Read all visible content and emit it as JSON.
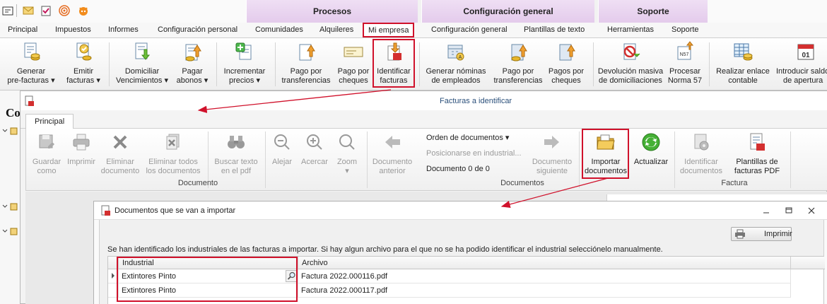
{
  "ribbon_groups": {
    "procesos": "Procesos",
    "configuracion": "Configuración general",
    "soporte": "Soporte"
  },
  "tabs": [
    "Principal",
    "Impuestos",
    "Informes",
    "Configuración personal",
    "Comunidades",
    "Alquileres",
    "Mi empresa",
    "Configuración general",
    "Plantillas de texto",
    "Herramientas",
    "Soporte"
  ],
  "ribbon_buttons": {
    "generar_prefacturas": [
      "Generar",
      "pre-facturas ▾"
    ],
    "emitir_facturas": [
      "Emitir",
      "facturas ▾"
    ],
    "domiciliar": [
      "Domiciliar",
      "Vencimientos ▾"
    ],
    "pagar_abonos": [
      "Pagar",
      "abonos ▾"
    ],
    "incrementar_precios": [
      "Incrementar",
      "precios ▾"
    ],
    "pago_transferencias": [
      "Pago por",
      "transferencias"
    ],
    "pago_cheques": [
      "Pago por",
      "cheques"
    ],
    "identificar_facturas": [
      "Identificar",
      "facturas"
    ],
    "generar_nominas": [
      "Generar nóminas",
      "de empleados"
    ],
    "pagos_transferencias": [
      "Pago por",
      "transferencias"
    ],
    "pagos_cheques": [
      "Pagos por",
      "cheques"
    ],
    "devolucion_masiva": [
      "Devolución masiva",
      "de domiciliaciones"
    ],
    "procesar_norma": [
      "Procesar",
      "Norma 57"
    ],
    "realizar_enlace": [
      "Realizar enlace",
      "contable"
    ],
    "introducir_saldo": [
      "Introducir saldo",
      "de apertura"
    ]
  },
  "left_partial_text": "Co",
  "facturas_window": {
    "title": "Facturas a identificar",
    "tab": "Principal",
    "buttons": {
      "guardar": [
        "Guardar",
        "como"
      ],
      "imprimir": [
        "Imprimir",
        ""
      ],
      "eliminar": [
        "Eliminar",
        "documento"
      ],
      "eliminar_todos": [
        "Eliminar todos",
        "los documentos"
      ],
      "buscar_texto": [
        "Buscar texto",
        "en el pdf"
      ],
      "alejar": [
        "Alejar",
        ""
      ],
      "acercar": [
        "Acercar",
        ""
      ],
      "zoom": [
        "Zoom",
        "▾"
      ],
      "doc_anterior": [
        "Documento",
        "anterior"
      ],
      "doc_siguiente": [
        "Documento",
        "siguiente"
      ],
      "importar": [
        "Importar",
        "documentos"
      ],
      "actualizar": [
        "Actualizar",
        ""
      ],
      "identificar_docs": [
        "Identificar",
        "documentos"
      ],
      "plantillas_pdf": [
        "Plantillas de",
        "facturas PDF"
      ]
    },
    "orden_label": "Orden de documentos ▾",
    "posicionarse": "Posicionarse en industrial...",
    "doc_counter": "Documento 0 de 0",
    "group_labels": {
      "documento": "Documento",
      "documentos": "Documentos",
      "factura": "Factura"
    }
  },
  "dialog": {
    "title": "Documentos que se van a importar",
    "print_label": "Imprimir",
    "message": "Se han identificado los industriales de las facturas a importar. Si hay algun archivo para el que no se ha podido identificar el industrial selecciónelo manualmente.",
    "columns": [
      "Industrial",
      "Archivo"
    ],
    "rows": [
      {
        "industrial": "Extintores Pinto",
        "archivo": "Factura 2022.000116.pdf"
      },
      {
        "industrial": "Extintores Pinto",
        "archivo": "Factura 2022.000117.pdf"
      }
    ]
  },
  "colors": {
    "highlight_red": "#d0112b",
    "group_header": "#e9d3f0"
  }
}
